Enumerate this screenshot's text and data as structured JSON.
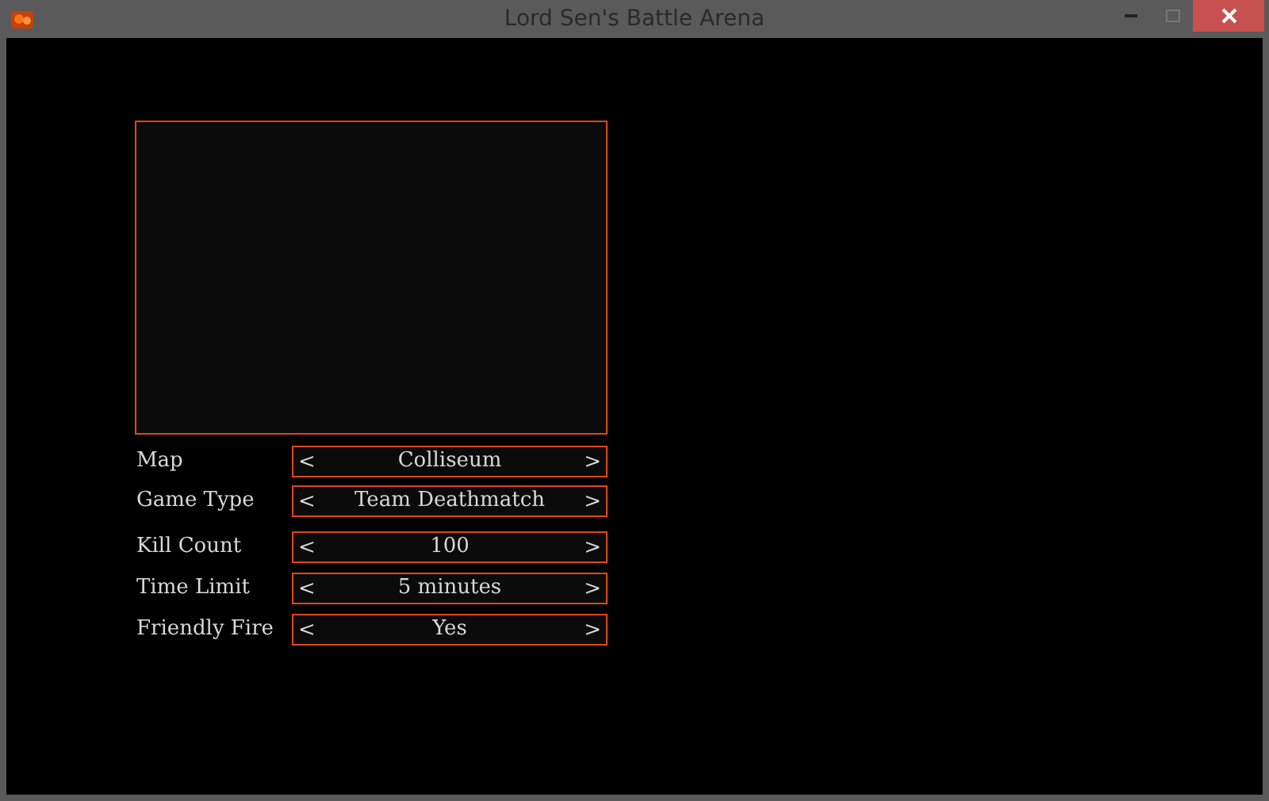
{
  "window": {
    "title": "Lord Sen's Battle Arena"
  },
  "settings": [
    {
      "label": "Map",
      "prev": "<",
      "value": "Colliseum",
      "next": ">"
    },
    {
      "label": "Game Type",
      "prev": "<",
      "value": "Team Deathmatch",
      "next": ">"
    },
    {
      "label": "Kill Count",
      "prev": "<",
      "value": "100",
      "next": ">"
    },
    {
      "label": "Time Limit",
      "prev": "<",
      "value": "5 minutes",
      "next": ">"
    },
    {
      "label": "Friendly Fire",
      "prev": "<",
      "value": "Yes",
      "next": ">"
    }
  ]
}
